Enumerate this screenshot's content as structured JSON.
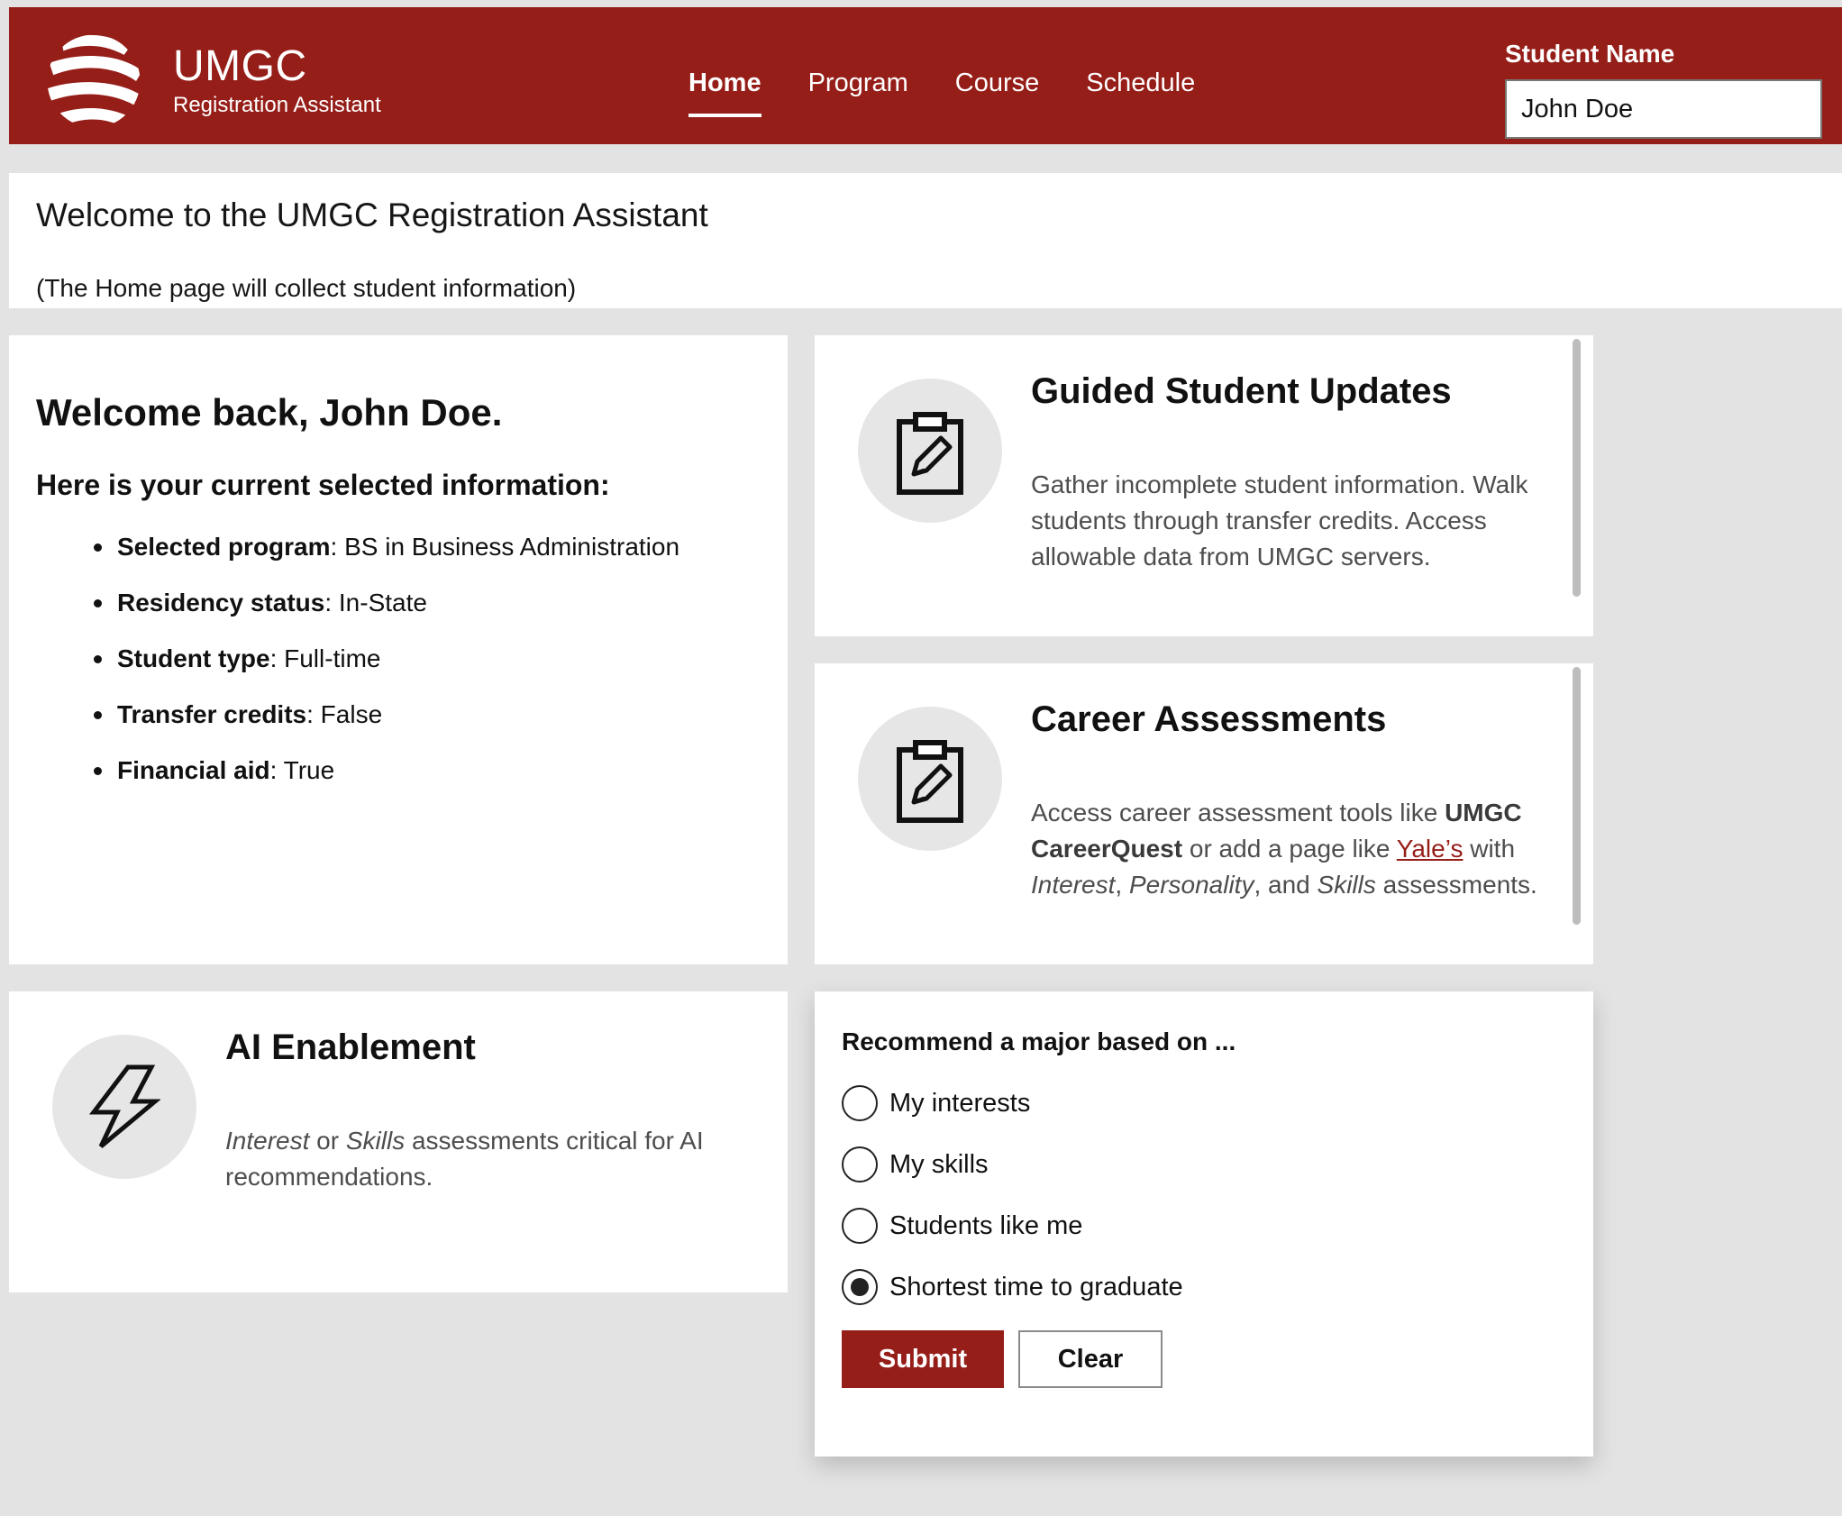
{
  "header": {
    "brand_title": "UMGC",
    "brand_subtitle": "Registration Assistant",
    "nav": [
      {
        "label": "Home",
        "active": true
      },
      {
        "label": "Program",
        "active": false
      },
      {
        "label": "Course",
        "active": false
      },
      {
        "label": "Schedule",
        "active": false
      }
    ],
    "student_label": "Student Name",
    "student_value": "John Doe",
    "colors": {
      "brand": "#961e19",
      "text": "#ffffff"
    }
  },
  "welcome": {
    "title": "Welcome to the UMGC Registration Assistant",
    "note": "(The Home page will collect student information)"
  },
  "info_card": {
    "heading": "Welcome back, John Doe.",
    "subheading": "Here is your current selected information:",
    "items": [
      {
        "key": "Selected program",
        "value": ": BS in Business Administration"
      },
      {
        "key": "Residency status",
        "value": ": In-State"
      },
      {
        "key": "Student type",
        "value": ": Full-time"
      },
      {
        "key": "Transfer credits",
        "value": ": False"
      },
      {
        "key": "Financial aid",
        "value": ": True"
      }
    ]
  },
  "features": {
    "updates": {
      "icon": "clipboard-edit-icon",
      "title": "Guided Student Updates",
      "body": "Gather incomplete student information. Walk students through transfer credits. Access allowable data from UMGC servers."
    },
    "career": {
      "icon": "clipboard-edit-icon",
      "title": "Career Assessments",
      "body_1": "Access career assessment tools like ",
      "bold": "UMGC CareerQuest",
      "body_2": " or add a page like ",
      "link": "Yale’s",
      "body_3": " with ",
      "em_1": "Interest",
      "sep_1": ", ",
      "em_2": "Personality",
      "sep_2": ", and ",
      "em_3": "Skills",
      "body_4": " assessments."
    },
    "ai": {
      "icon": "lightning-icon",
      "title": "AI Enablement",
      "em_1": "Interest",
      "body_1": " or ",
      "em_2": "Skills",
      "body_2": " assessments critical for AI recommendations."
    }
  },
  "form": {
    "legend": "Recommend a major based on ...",
    "options": [
      {
        "label": "My interests",
        "checked": false
      },
      {
        "label": "My skills",
        "checked": false
      },
      {
        "label": "Students like me",
        "checked": false
      },
      {
        "label": "Shortest time to graduate",
        "checked": true
      }
    ],
    "submit_label": "Submit",
    "clear_label": "Clear"
  }
}
